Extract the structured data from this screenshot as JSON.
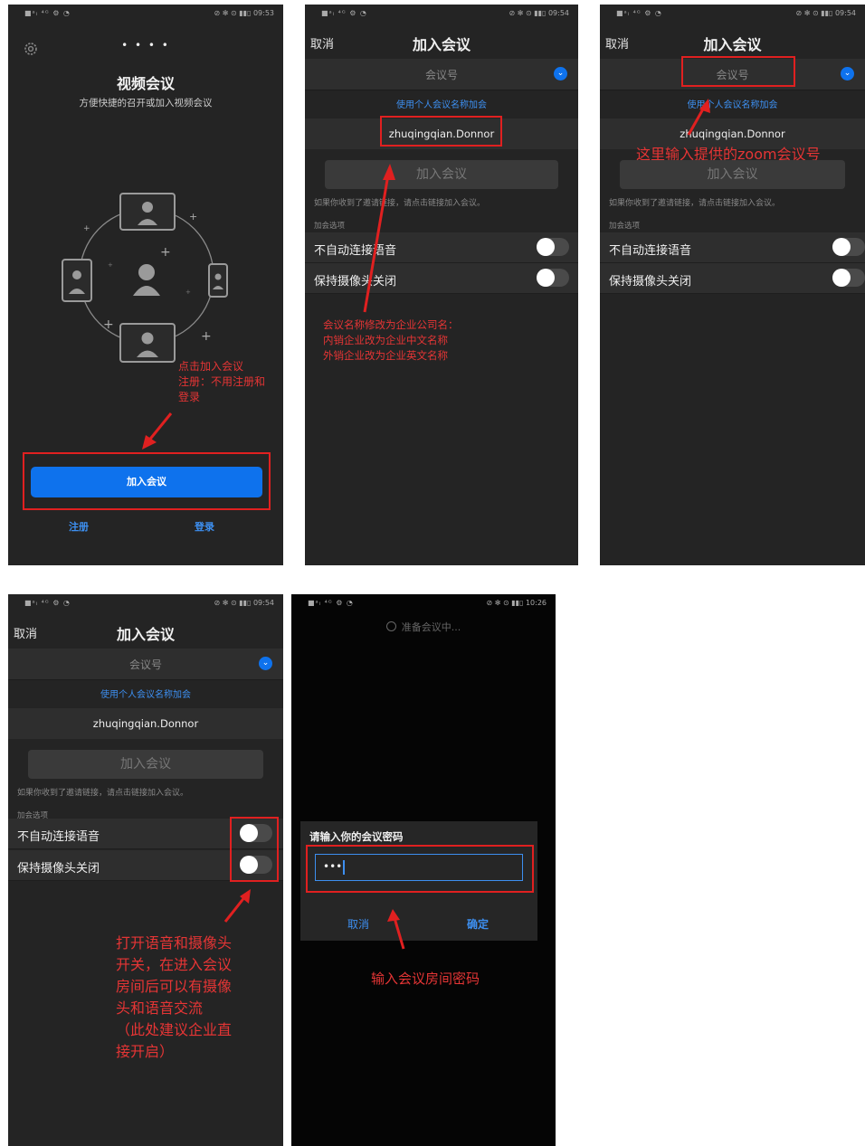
{
  "status_bar": {
    "left": "■ᵃₗ ⁴ᴳ ⚙ ◔",
    "time1": "⊘ ✻ ⊙ ▮▮▯ 09:53",
    "time2": "⊘ ✻ ⊙ ▮▮▯ 09:54",
    "time5": "⊘ ✻ ⊙ ▮▮▯ 10:26"
  },
  "screen1": {
    "title": "视频会议",
    "subtitle": "方便快捷的召开或加入视频会议",
    "dots": "• • • •",
    "join_button": "加入会议",
    "signup": "注册",
    "login": "登录",
    "annotation": [
      "点击加入会议",
      "注册：不用注册和",
      "登录"
    ]
  },
  "join_screen": {
    "cancel": "取消",
    "title": "加入会议",
    "meeting_id_placeholder": "会议号",
    "personal_link": "使用个人会议名称加会",
    "name": "zhuqingqian.Donnor",
    "join_button": "加入会议",
    "hint": "如果你收到了邀请链接，请点击链接加入会议。",
    "options_label": "加会选项",
    "option_audio": "不自动连接语音",
    "option_video": "保持摄像头关闭"
  },
  "screen2_annotation": [
    "会议名称修改为企业公司名：",
    "内销企业改为企业中文名称",
    "外销企业改为企业英文名称"
  ],
  "screen3_annotation": "这里输入提供的zoom会议号",
  "screen4_annotation": [
    "打开语音和摄像头",
    "开关，在进入会议",
    "房间后可以有摄像",
    "头和语音交流",
    "（此处建议企业直",
    "接开启）"
  ],
  "screen5": {
    "connecting": "准备会议中...",
    "dialog_title": "请输入你的会议密码",
    "password_value": "•••",
    "cancel": "取消",
    "ok": "确定",
    "annotation": "输入会议房间密码"
  },
  "colors": {
    "accent": "#0e72ed",
    "link": "#3d8ff0",
    "annotation": "#e02020",
    "bg": "#242424"
  }
}
